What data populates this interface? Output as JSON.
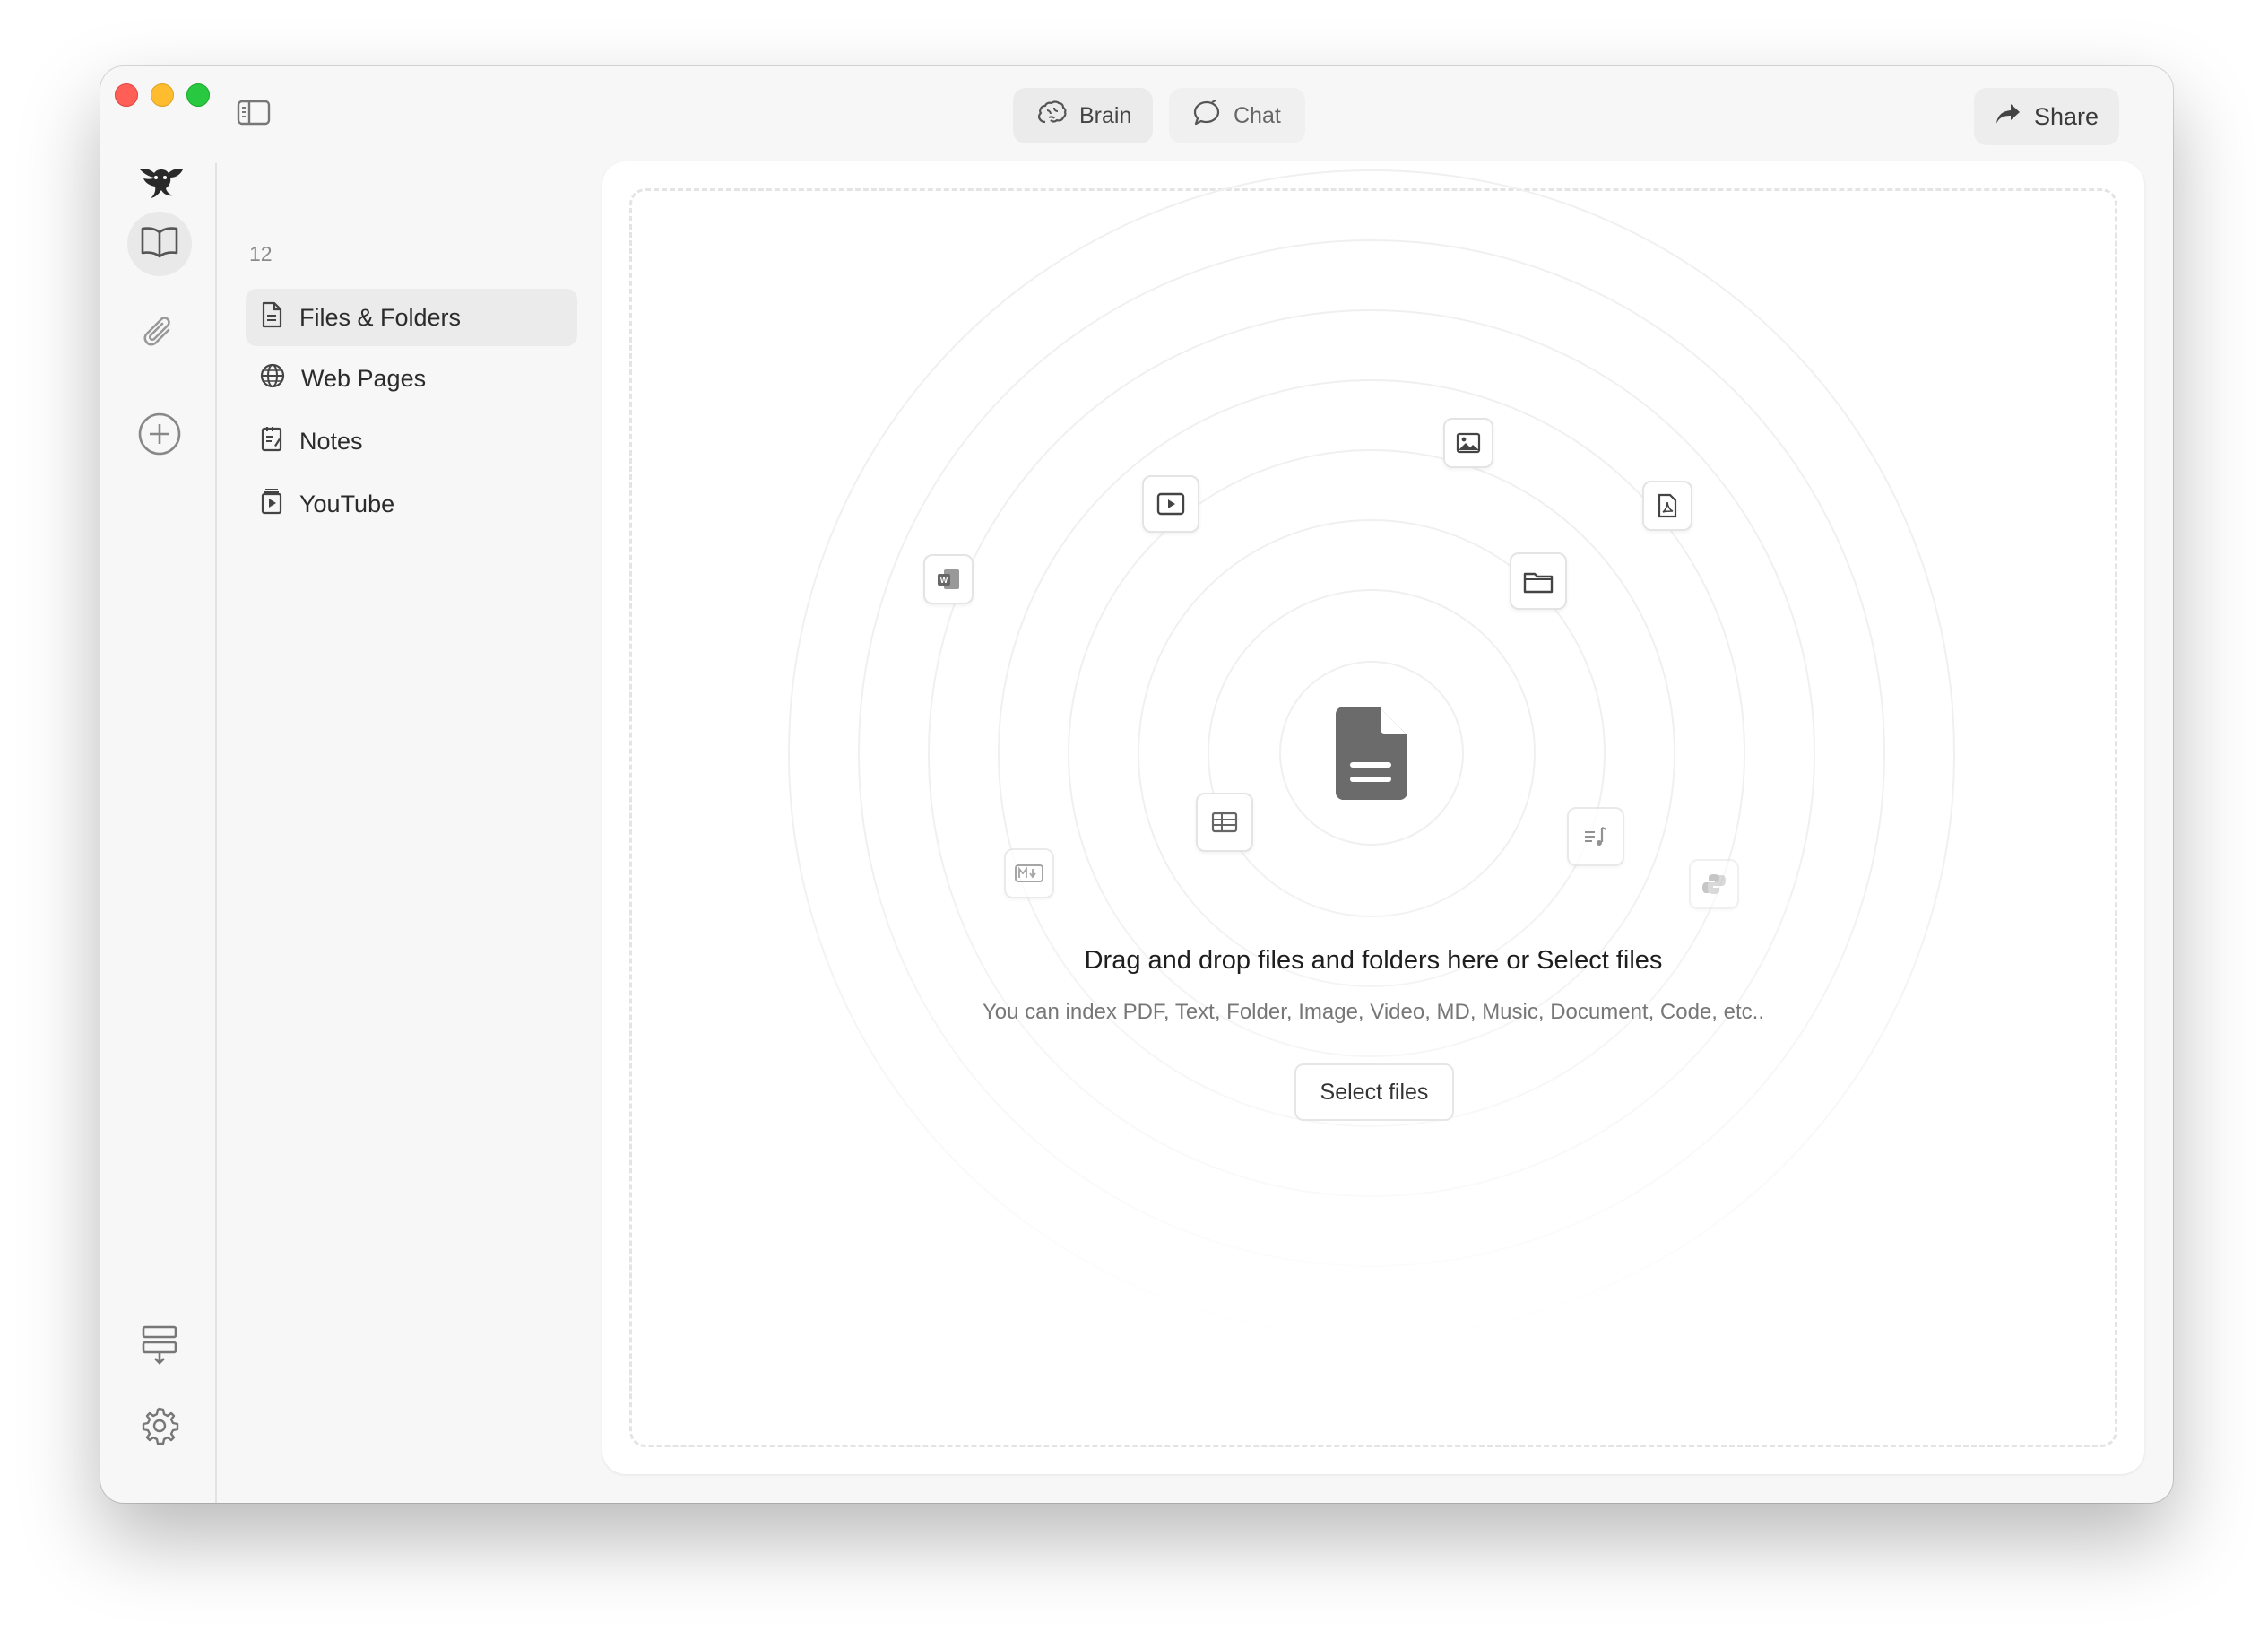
{
  "titlebar": {
    "brain_label": "Brain",
    "chat_label": "Chat",
    "share_label": "Share"
  },
  "panel": {
    "count": "12",
    "items": [
      {
        "label": "Files & Folders",
        "icon": "file-icon",
        "active": true
      },
      {
        "label": "Web Pages",
        "icon": "globe-icon",
        "active": false
      },
      {
        "label": "Notes",
        "icon": "notes-icon",
        "active": false
      },
      {
        "label": "YouTube",
        "icon": "youtube-icon",
        "active": false
      }
    ]
  },
  "dropzone": {
    "title": "Drag and drop files and folders here or Select files",
    "subtitle": "You can index PDF, Text, Folder, Image, Video, MD, Music, Document, Code, etc..",
    "select_label": "Select files",
    "orbit_icons": [
      "word-doc-icon",
      "video-icon",
      "image-icon",
      "pdf-icon",
      "folder-icon",
      "table-icon",
      "markdown-icon",
      "music-icon",
      "python-icon"
    ]
  },
  "colors": {
    "accent_icon": "#6b6b6b",
    "window_bg": "#f7f7f7",
    "content_bg": "#ffffff"
  }
}
